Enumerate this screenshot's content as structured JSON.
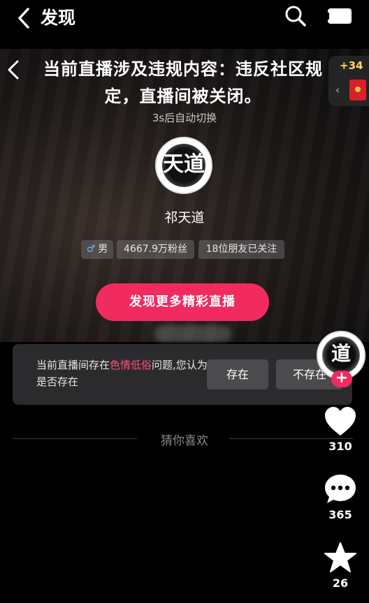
{
  "nav": {
    "title": "发现"
  },
  "live": {
    "ban_message": "当前直播涉及违规内容：违反社区规定，直播间被关闭。",
    "countdown": "3s后自动切换",
    "side_badge": "+34",
    "side_arrow": "‹"
  },
  "streamer": {
    "avatar_glyph": "天道",
    "name": "祁天道",
    "tags": {
      "gender_symbol": "♂",
      "gender": "男",
      "fans": "4667.9万粉丝",
      "friends": "18位朋友已关注"
    }
  },
  "discover_button": "发现更多精彩直播",
  "survey": {
    "prefix": "当前直播间存在",
    "highlight": "色情低俗",
    "suffix": "问题,您认为是否存在",
    "yes": "存在",
    "no": "不存在"
  },
  "section": {
    "guess": "猜你喜欢"
  },
  "sidebar": {
    "avatar_glyph": "道",
    "follow_plus": "+",
    "likes": "310",
    "comments": "365",
    "favorites": "26"
  },
  "colors": {
    "accent": "#f12a5f",
    "highlight": "#ff4f7a"
  }
}
